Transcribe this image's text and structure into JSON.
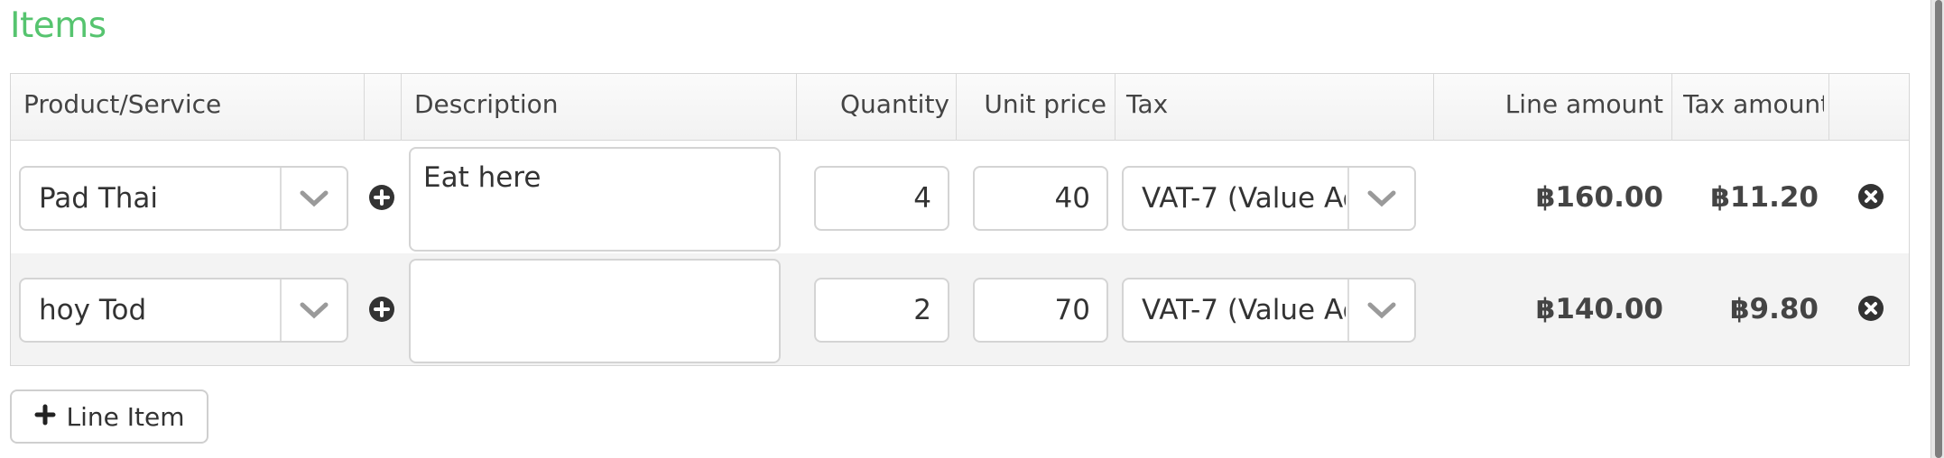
{
  "section": {
    "title": "Items"
  },
  "table": {
    "headers": {
      "product": "Product/Service",
      "description": "Description",
      "quantity": "Quantity",
      "unit_price": "Unit price",
      "tax": "Tax",
      "line_amount": "Line amount",
      "tax_amount": "Tax amount"
    },
    "rows": [
      {
        "product": "Pad Thai",
        "description": "Eat here",
        "quantity": "4",
        "unit_price": "40",
        "tax": "VAT-7 (Value Ad",
        "line_amount": "฿160.00",
        "tax_amount": "฿11.20"
      },
      {
        "product": "hoy Tod",
        "description": "",
        "quantity": "2",
        "unit_price": "70",
        "tax": "VAT-7 (Value Ad",
        "line_amount": "฿140.00",
        "tax_amount": "฿9.80"
      }
    ]
  },
  "actions": {
    "add_line_label": "Line Item"
  },
  "icons": {
    "dropdown": "chevron-down-icon",
    "add": "plus-circle-icon",
    "remove": "times-circle-icon",
    "add_line": "plus-icon"
  },
  "colors": {
    "title": "#56c46f",
    "row_alt": "#f3f3f3"
  }
}
